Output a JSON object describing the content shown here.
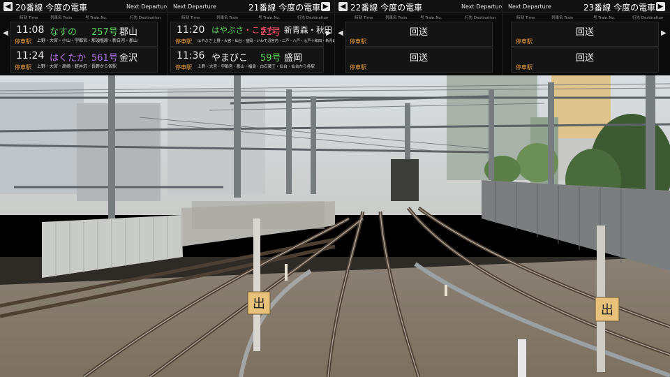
{
  "boards": [
    {
      "track": "20番線",
      "heading": "今度の電車",
      "next": "Next Departure",
      "cols": {
        "time": "時刻 Time",
        "train": "列車名 Train",
        "no": "号 Train No.",
        "dest": "行先 Destination"
      },
      "rows": [
        {
          "time": "11:08",
          "name": "なすの",
          "name_color": "#5ad25a",
          "num": "257号",
          "num_color": "#5ad25a",
          "dest": "郡山",
          "stop_label": "停車駅",
          "stops": "上野・大宮・小山・宇都宮・那須塩原・新白河・郡山"
        },
        {
          "time": "11:24",
          "name": "はくたか",
          "name_color": "#b070e0",
          "num": "561号",
          "num_color": "#b070e0",
          "dest": "金沢",
          "stop_label": "停車駅",
          "stops": "上野・大宮・高崎・軽井沢・長野から各駅"
        }
      ]
    },
    {
      "track": "21番線",
      "heading": "今度の電車",
      "next": "Next Departure",
      "cols": {
        "time": "時刻 Time",
        "train": "列車名 Train",
        "no": "号 Train No.",
        "dest": "行先 Destination"
      },
      "rows": [
        {
          "time": "11:20",
          "name": "はやぶさ",
          "name_color": "#5ad25a",
          "name2": "・こまち",
          "name2_color": "#ff4f6a",
          "num": "21号",
          "num_color": "#ff4f6a",
          "dest": "新青森・秋田",
          "stop_label": "停車駅",
          "stops": "はやぶさ 上野・大宮・仙台・盛岡・いわて沼宮内・二戸・八戸・七戸十和田・新青森"
        },
        {
          "time": "11:36",
          "name": "やまびこ",
          "name_color": "#f2f2f2",
          "num": "59号",
          "num_color": "#5ad25a",
          "dest": "盛岡",
          "stop_label": "停車駅",
          "stops": "上野・大宮・宇都宮・郡山・福島・白石蔵王・仙台・仙台から各駅"
        }
      ]
    },
    {
      "track": "22番線",
      "heading": "今度の電車",
      "next": "Next Departure",
      "cols": {
        "time": "時刻 Time",
        "train": "列車名 Train",
        "no": "号 Train No.",
        "dest": "行先 Destination"
      },
      "rows": [
        {
          "kaiso": "回送",
          "stop_label": "停車駅"
        },
        {
          "kaiso": "回送",
          "stop_label": "停車駅"
        }
      ]
    },
    {
      "track": "23番線",
      "heading": "今度の電車",
      "next": "Next Departure",
      "cols": {
        "time": "時刻 Time",
        "train": "列車名 Train",
        "no": "号 Train No.",
        "dest": "行先 Destination"
      },
      "rows": [
        {
          "kaiso": "回送",
          "stop_label": "停車駅"
        },
        {
          "kaiso": "回送",
          "stop_label": "停車駅"
        }
      ]
    }
  ],
  "signs": {
    "exit_left": "出",
    "exit_right": "出"
  },
  "icons": {
    "prev": "chevron-left-icon",
    "next": "chevron-right-icon"
  },
  "colors": {
    "stop_label": "#f2a13b",
    "board_bg": "#0b0b0b"
  }
}
